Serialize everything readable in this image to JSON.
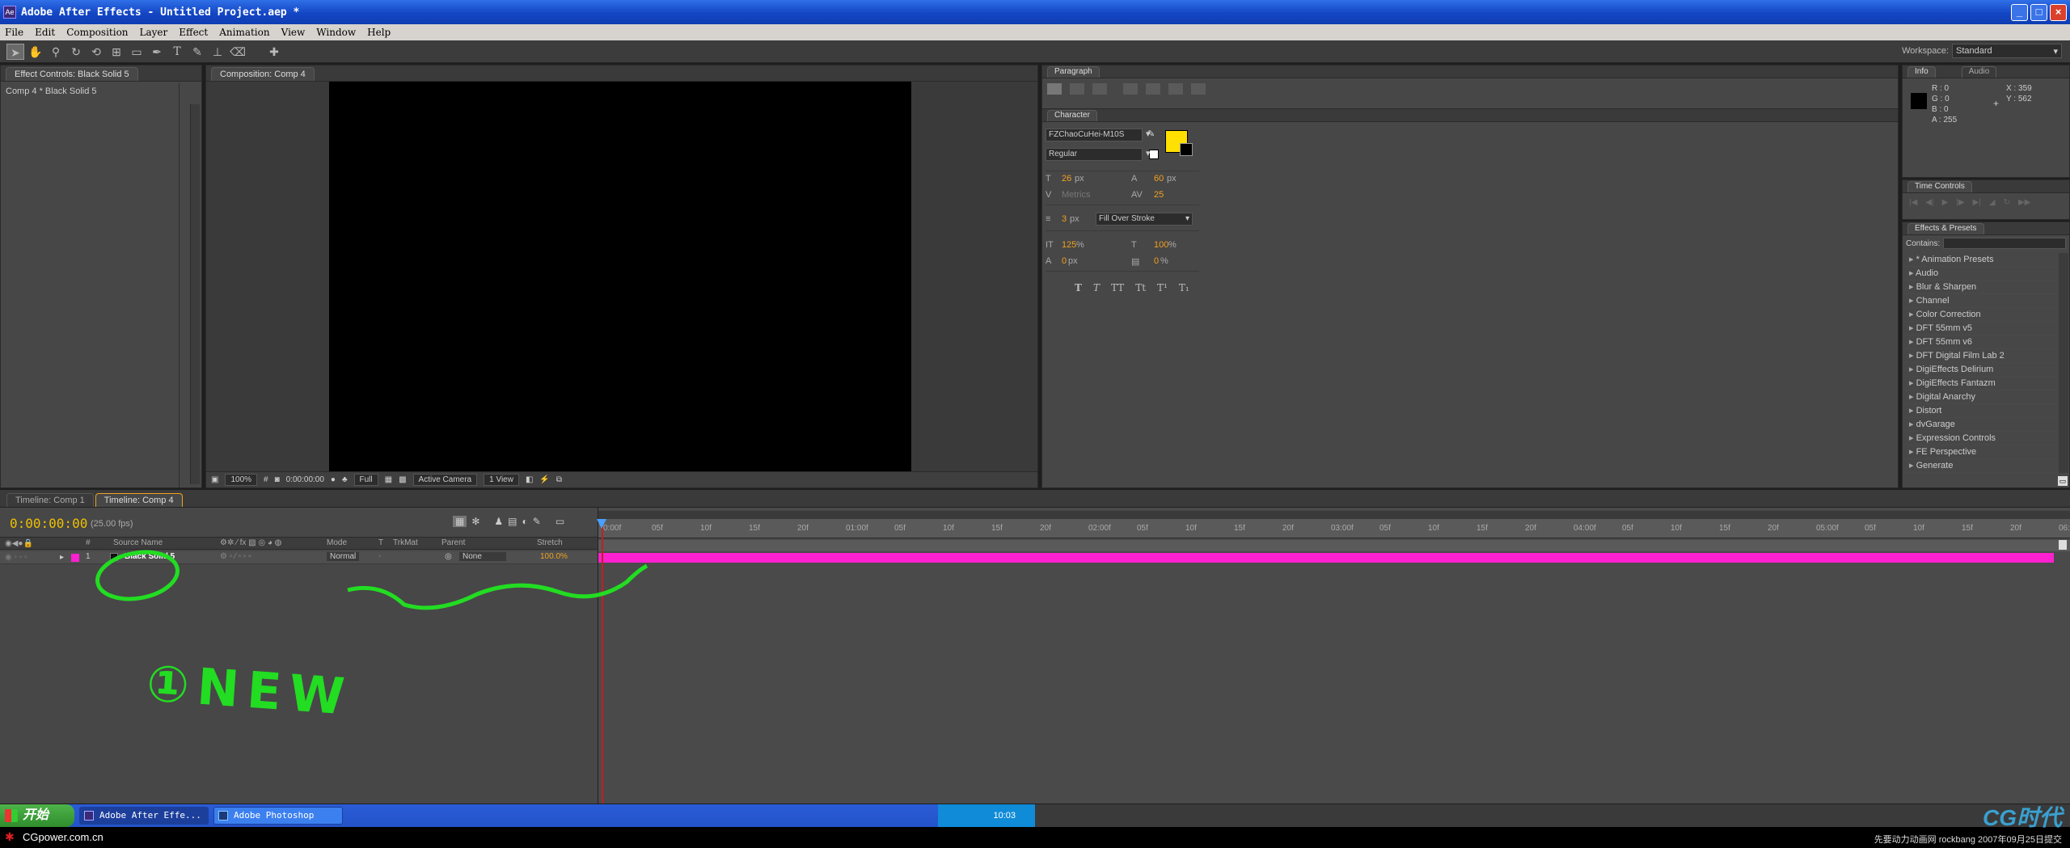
{
  "app": {
    "title": "Adobe After Effects - Untitled Project.aep *",
    "app_icon": "Ae",
    "window_buttons": [
      "_",
      "□",
      "×"
    ]
  },
  "menu": [
    "File",
    "Edit",
    "Composition",
    "Layer",
    "Effect",
    "Animation",
    "View",
    "Window",
    "Help"
  ],
  "toolbar": {
    "tools": [
      "selection-tool",
      "hand-tool",
      "zoom-tool",
      "rotation-tool",
      "orbit-camera-tool",
      "pan-behind-tool",
      "rectangle-mask-tool",
      "pen-tool",
      "text-tool",
      "clone-stamp-tool",
      "brush-tool",
      "eraser-tool",
      "puppet-pin-tool"
    ],
    "workspace_label": "Workspace:",
    "workspace_value": "Standard"
  },
  "effect_controls": {
    "tab": "Effect Controls: Black Solid 5",
    "breadcrumb": "Comp 4 * Black Solid 5"
  },
  "composition": {
    "tab": "Composition: Comp 4",
    "zoom": "100%",
    "timecode": "0:00:00:00",
    "resolution": "Full",
    "camera": "Active Camera",
    "view": "1 View"
  },
  "paragraph": {
    "tab": "Paragraph"
  },
  "character": {
    "tab": "Character",
    "font": "FZChaoCuHei-M10S",
    "style": "Regular",
    "size": "26",
    "size_unit": "px",
    "leading": "60",
    "leading_unit": "px",
    "kerning": "Metrics",
    "tracking": "25",
    "stroke_width": "3",
    "stroke_unit": "px",
    "stroke_mode": "Fill Over Stroke",
    "vscale": "125",
    "hscale": "100",
    "baseline": "0",
    "baseline_unit": "px",
    "tsume": "0",
    "tsume_unit": "%",
    "fill_color": "#ffe000",
    "styles": [
      "T",
      "T",
      "TT",
      "Tt",
      "T¹",
      "T₁"
    ]
  },
  "info": {
    "tab": "Info",
    "tab2": "Audio",
    "r": "R : 0",
    "g": "G : 0",
    "b": "B : 0",
    "a": "A : 255",
    "x": "X : 359",
    "y": "Y : 562"
  },
  "time_controls": {
    "tab": "Time Controls"
  },
  "effects_presets": {
    "tab": "Effects & Presets",
    "contains_label": "Contains:",
    "items": [
      "* Animation Presets",
      "Audio",
      "Blur & Sharpen",
      "Channel",
      "Color Correction",
      "DFT 55mm v5",
      "DFT 55mm v6",
      "DFT Digital Film Lab 2",
      "DigiEffects Delirium",
      "DigiEffects Fantazm",
      "Digital Anarchy",
      "Distort",
      "dvGarage",
      "Expression Controls",
      "FE Perspective",
      "Generate"
    ]
  },
  "timeline": {
    "tabs": [
      "Timeline: Comp 1",
      "Timeline: Comp 4"
    ],
    "timecode": "0:00:00:00",
    "fps": "(25.00 fps)",
    "columns": [
      "#",
      "Source Name",
      "Mode",
      "T",
      "TrkMat",
      "Parent",
      "Stretch"
    ],
    "layer": {
      "num": "1",
      "name": "Black Solid 5",
      "mode": "Normal",
      "parent": "None",
      "stretch": "100.0%",
      "label_color": "#ff20d0"
    },
    "ruler": [
      "0:00f",
      "05f",
      "10f",
      "15f",
      "20f",
      "01:00f",
      "05f",
      "10f",
      "15f",
      "20f",
      "02:00f",
      "05f",
      "10f",
      "15f",
      "20f",
      "03:00f",
      "05f",
      "10f",
      "15f",
      "20f",
      "04:00f",
      "05f",
      "10f",
      "15f",
      "20f",
      "05:00f",
      "05f",
      "10f",
      "15f",
      "20f",
      "06:0"
    ]
  },
  "annotation": {
    "text": "①NEW",
    "color": "#22dd22"
  },
  "taskbar": {
    "start": "开始",
    "items": [
      "Adobe After Effe...",
      "Adobe Photoshop"
    ],
    "clock": "10:03"
  },
  "watermark": {
    "left": "CGpower.com.cn",
    "right": "先要动力动画网 rockbang 2007年09月25日提交",
    "logo": "CG时代"
  }
}
